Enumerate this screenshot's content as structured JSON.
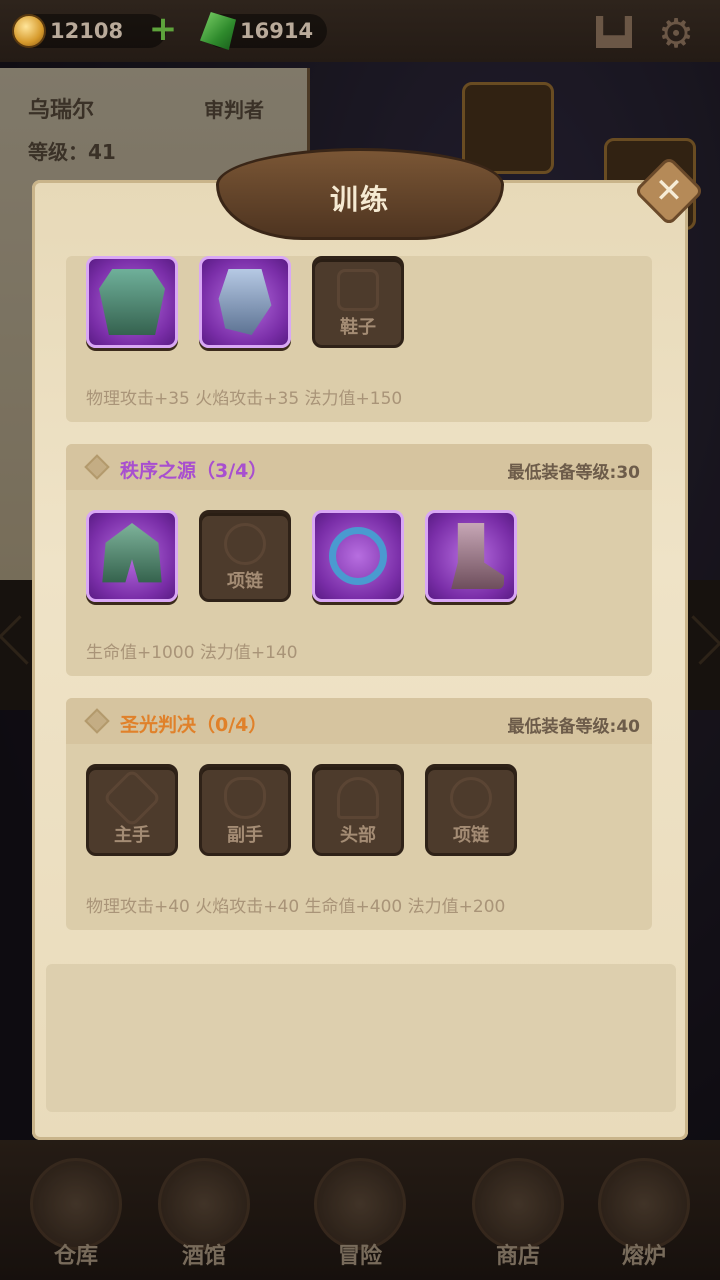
{
  "resources": {
    "gold": "12108",
    "gems": "16914"
  },
  "background_hero": {
    "name": "乌瑞尔",
    "role": "审判者",
    "level_label": "等级：",
    "level": "41"
  },
  "modal": {
    "title": "训练"
  },
  "sets": [
    {
      "name": "",
      "name_color": "#b04fd0",
      "slots": [
        {
          "state": "filled",
          "item": "armor-icon",
          "label": ""
        },
        {
          "state": "filled",
          "item": "gauntlet-icon",
          "label": ""
        },
        {
          "state": "empty",
          "item": "",
          "label": "鞋子"
        }
      ],
      "bonus": "物理攻击+35  火焰攻击+35  法力值+150"
    },
    {
      "name": "秩序之源（3/4）",
      "name_color": "#a84fcf",
      "requirement": "最低装备等级:30",
      "slots": [
        {
          "state": "filled",
          "item": "helmet-icon",
          "label": ""
        },
        {
          "state": "empty",
          "item": "",
          "label": "项链"
        },
        {
          "state": "filled",
          "item": "ring-icon",
          "label": ""
        },
        {
          "state": "filled",
          "item": "boots-icon",
          "label": ""
        }
      ],
      "bonus": "生命值+1000  法力值+140"
    },
    {
      "name": "圣光判决（0/4）",
      "name_color": "#e0812a",
      "requirement": "最低装备等级:40",
      "slots": [
        {
          "state": "empty",
          "item": "",
          "label": "主手"
        },
        {
          "state": "empty",
          "item": "",
          "label": "副手"
        },
        {
          "state": "empty",
          "item": "",
          "label": "头部"
        },
        {
          "state": "empty",
          "item": "",
          "label": "项链"
        }
      ],
      "bonus": "物理攻击+40  火焰攻击+40  生命值+400  法力值+200"
    }
  ],
  "nav": [
    {
      "label": "仓库"
    },
    {
      "label": "酒馆"
    },
    {
      "label": "冒险"
    },
    {
      "label": "商店"
    },
    {
      "label": "熔炉"
    }
  ]
}
